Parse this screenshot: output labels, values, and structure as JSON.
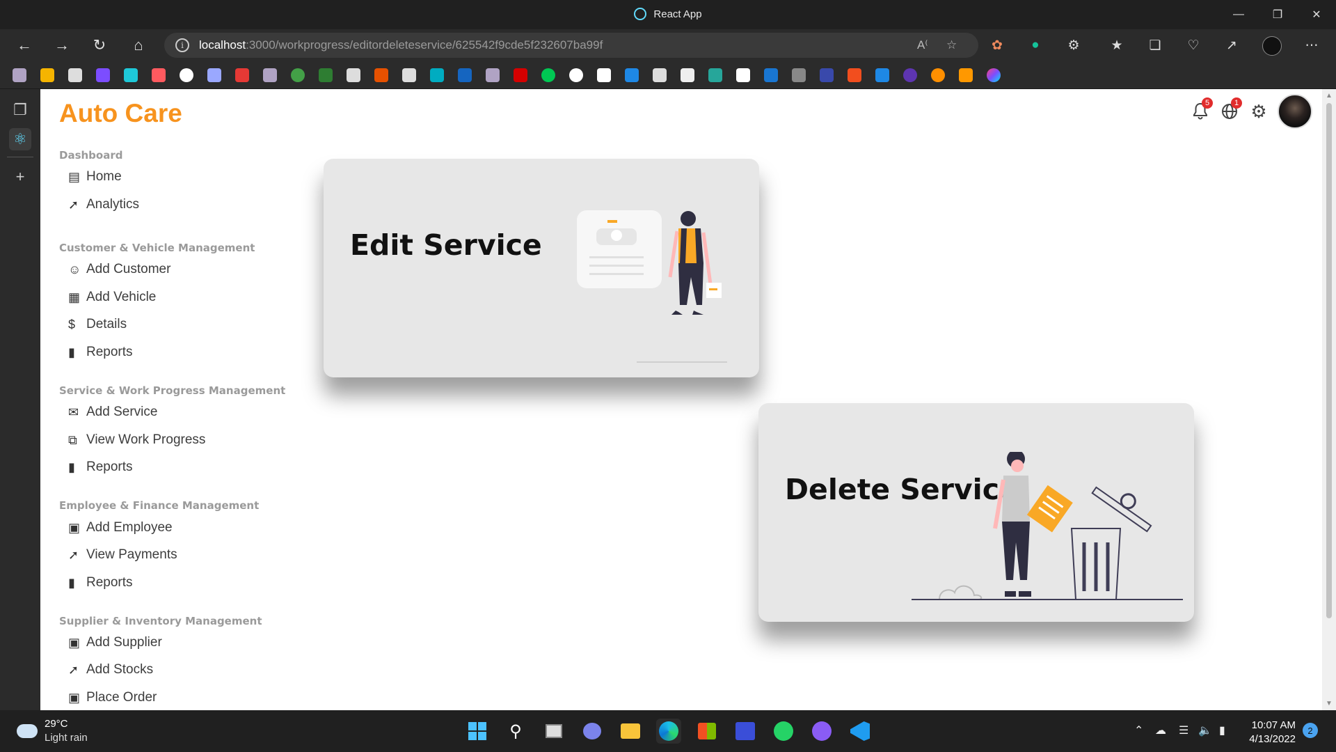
{
  "browser": {
    "window_title": "React App",
    "url_host": "localhost",
    "url_path": ":3000/workprogress/editordeleteservice/625542f9cde5f232607ba99f",
    "window_controls": [
      "minimize",
      "restore",
      "close"
    ]
  },
  "app": {
    "brand": "Auto Care",
    "notifications_count": "5",
    "language_count": "1"
  },
  "sidebar": {
    "sections": [
      {
        "title": "Dashboard",
        "items": [
          {
            "label": "Home",
            "icon": "table-icon"
          },
          {
            "label": "Analytics",
            "icon": "trend-icon"
          }
        ]
      },
      {
        "title": "Customer & Vehicle Management",
        "items": [
          {
            "label": "Add Customer",
            "icon": "person-icon"
          },
          {
            "label": "Add Vehicle",
            "icon": "store-icon"
          },
          {
            "label": "Details",
            "icon": "dollar-icon"
          },
          {
            "label": "Reports",
            "icon": "bar-chart-icon"
          }
        ]
      },
      {
        "title": "Service & Work Progress Management",
        "items": [
          {
            "label": "Add Service",
            "icon": "mail-icon"
          },
          {
            "label": "View Work Progress",
            "icon": "library-icon"
          },
          {
            "label": "Reports",
            "icon": "bar-chart-icon"
          }
        ]
      },
      {
        "title": "Employee & Finance Management",
        "items": [
          {
            "label": "Add Employee",
            "icon": "briefcase-icon"
          },
          {
            "label": "View Payments",
            "icon": "trend-icon"
          },
          {
            "label": "Reports",
            "icon": "bar-chart-icon"
          }
        ]
      },
      {
        "title": "Supplier & Inventory Management",
        "items": [
          {
            "label": "Add Supplier",
            "icon": "briefcase-icon"
          },
          {
            "label": "Add Stocks",
            "icon": "trend-icon"
          },
          {
            "label": "Place Order",
            "icon": "briefcase-icon"
          }
        ]
      }
    ]
  },
  "cards": {
    "edit": {
      "title": "Edit Service"
    },
    "delete": {
      "title": "Delete Service"
    }
  },
  "taskbar": {
    "temperature": "29°C",
    "weather": "Light rain",
    "time": "10:07 AM",
    "date": "4/13/2022",
    "notification_count": "2"
  },
  "colors": {
    "brand": "#f7931e",
    "card_bg": "#e7e7e7",
    "illustration_accent": "#f9a826"
  }
}
